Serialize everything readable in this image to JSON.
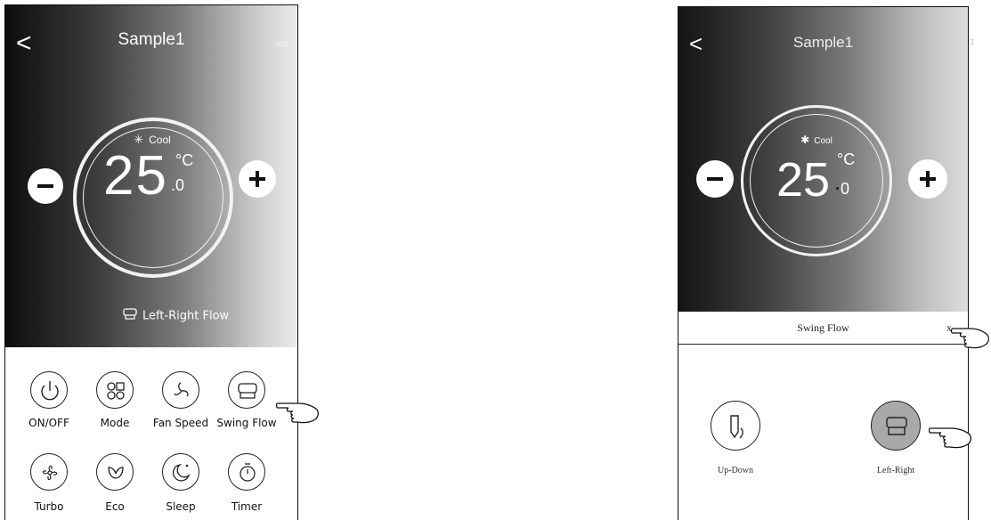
{
  "screen1": {
    "back_label": "<",
    "title": "Sample1",
    "more_label": "○○○",
    "mode": "Cool",
    "temperature": "25",
    "unit": "°C",
    "decimal": ".0",
    "minus_label": "−",
    "plus_label": "+",
    "flow_status": "Left-Right Flow",
    "functions": [
      {
        "label": "ON/OFF",
        "icon": "power-icon"
      },
      {
        "label": "Mode",
        "icon": "mode-grid-icon"
      },
      {
        "label": "Fan Speed",
        "icon": "fan-icon"
      },
      {
        "label": "Swing Flow",
        "icon": "swing-flow-icon"
      },
      {
        "label": "Turbo",
        "icon": "turbo-icon"
      },
      {
        "label": "Eco",
        "icon": "eco-leaf-icon"
      },
      {
        "label": "Sleep",
        "icon": "sleep-moon-icon"
      },
      {
        "label": "Timer",
        "icon": "timer-icon"
      }
    ]
  },
  "screen2": {
    "back_label": "<",
    "title": "Sample1",
    "mode": "Cool",
    "temperature": "25",
    "unit": "°C",
    "decimal": "0",
    "sheet_title": "Swing Flow",
    "close_label": "x",
    "options": [
      {
        "label": "Up-Down",
        "icon": "up-down-flow-icon",
        "selected": false
      },
      {
        "label": "Left-Right",
        "icon": "left-right-flow-icon",
        "selected": true
      }
    ]
  },
  "colors": {
    "selected_fill": "#a9a9a9",
    "panel_bg": "#ffffff"
  }
}
